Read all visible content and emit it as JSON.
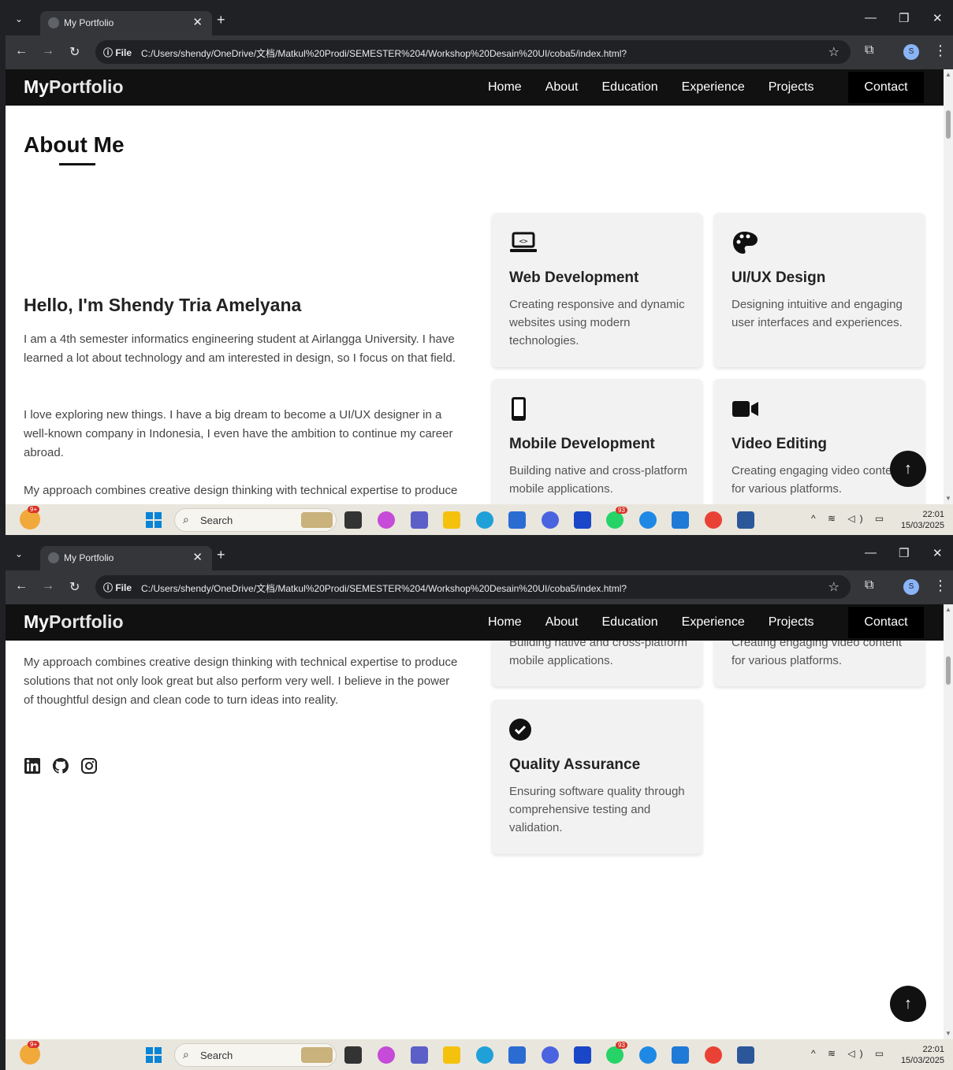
{
  "browser": {
    "tab_title": "My Portfolio",
    "url_prefix": "File",
    "url": "C:/Users/shendy/OneDrive/文档/Matkul%20Prodi/SEMESTER%204/Workshop%20Desain%20UI/coba5/index.html?",
    "profile_initial": "S"
  },
  "site": {
    "brand_my": "My",
    "brand_rest": "Portfolio",
    "nav": [
      "Home",
      "About",
      "Education",
      "Experience",
      "Projects"
    ],
    "contact_label": "Contact"
  },
  "about": {
    "title": "About Me",
    "greeting": "Hello, I'm Shendy Tria Amelyana",
    "paragraphs": [
      "I am a 4th semester informatics engineering student at Airlangga University. I have learned a lot about technology and am interested in design, so I focus on that field.",
      "I love exploring new things. I have a big dream to become a UI/UX designer in a well-known company in Indonesia, I even have the ambition to continue my career abroad.",
      "My approach combines creative design thinking with technical expertise to produce solutions that not only look great but also perform very well. I believe in the power of thoughtful design and clean code to turn ideas into reality."
    ],
    "social_icons": [
      "linkedin-icon",
      "github-icon",
      "instagram-icon"
    ]
  },
  "services": [
    {
      "icon": "laptop-code-icon",
      "title": "Web Development",
      "desc": "Creating responsive and dynamic websites using modern technologies."
    },
    {
      "icon": "palette-icon",
      "title": "UI/UX Design",
      "desc": "Designing intuitive and engaging user interfaces and experiences."
    },
    {
      "icon": "mobile-icon",
      "title": "Mobile Development",
      "desc": "Building native and cross-platform mobile applications."
    },
    {
      "icon": "video-icon",
      "title": "Video Editing",
      "desc": "Creating engaging video content for various platforms."
    },
    {
      "icon": "check-circle-icon",
      "title": "Quality Assurance",
      "desc": "Ensuring software quality through comprehensive testing and validation."
    }
  ],
  "taskbar": {
    "search_label": "Search",
    "weather_badge": "9+",
    "whatsapp_badge": "93",
    "time": "22:01",
    "date": "15/03/2025"
  },
  "colors": {
    "nav_bg": "#111111",
    "card_bg": "#f2f2f2",
    "accent": "#111111"
  }
}
